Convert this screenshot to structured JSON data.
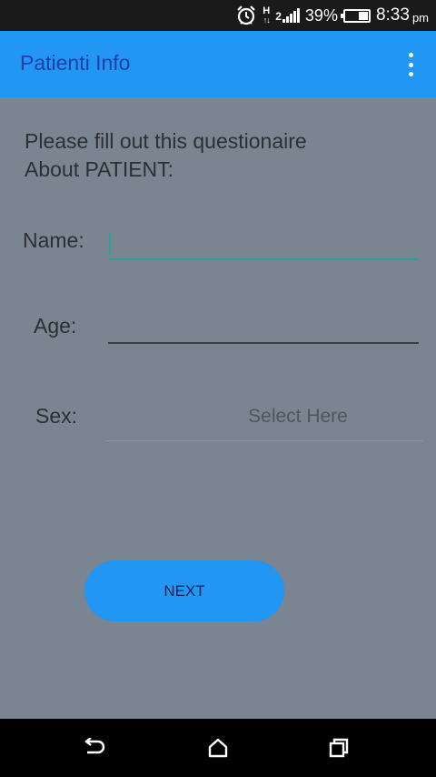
{
  "status_bar": {
    "network": "H",
    "signal_prefix": "2",
    "battery_percent": "39%",
    "battery_level": 0.39,
    "time": "8:33",
    "ampm": "pm",
    "icons": [
      "alarm-icon",
      "network-h-icon",
      "signal-icon",
      "battery-icon"
    ]
  },
  "app_bar": {
    "title": "Patienti Info",
    "overflow_icon": "more-vert-icon"
  },
  "form": {
    "intro_line1": "Please fill out this questionaire",
    "intro_line2": "About PATIENT:",
    "name_label": "Name:",
    "name_value": "",
    "age_label": "Age:",
    "age_value": "",
    "sex_label": "Sex:",
    "sex_value": "Select Here"
  },
  "next_button": {
    "label": "NEXT"
  },
  "nav_bar": {
    "back_icon": "back-icon",
    "home_icon": "home-icon",
    "recent_icon": "recent-apps-icon"
  },
  "colors": {
    "accent": "#2196f3",
    "background": "#7b8591",
    "focus": "#26a69a"
  }
}
